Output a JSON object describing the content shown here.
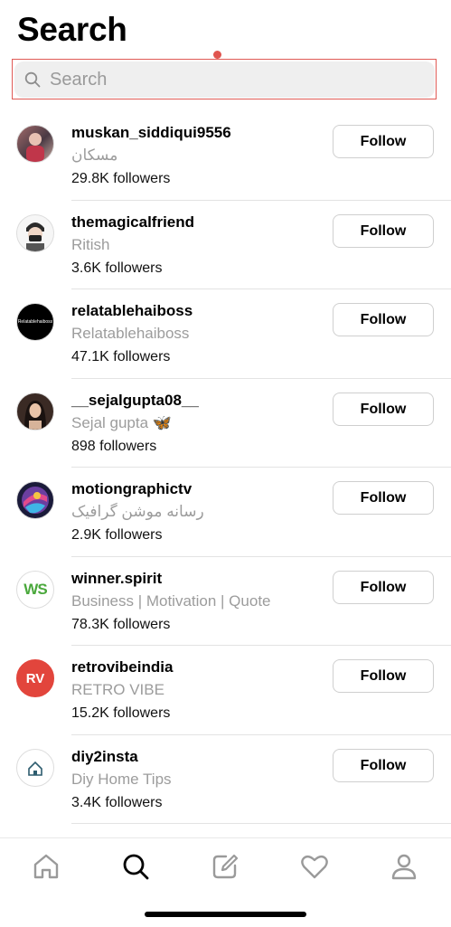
{
  "header": {
    "title": "Search"
  },
  "search": {
    "placeholder": "Search",
    "icon": "search-icon"
  },
  "follow_label": "Follow",
  "users": [
    {
      "username": "muskan_siddiqui9556",
      "display_name": "مسکان",
      "followers": "29.8K followers"
    },
    {
      "username": "themagicalfriend",
      "display_name": "Ritish",
      "followers": "3.6K followers"
    },
    {
      "username": "relatablehaiboss",
      "display_name": "Relatablehaiboss",
      "followers": "47.1K followers",
      "avatar_text": "Relatablehaiboss"
    },
    {
      "username": "__sejalgupta08__",
      "display_name": "Sejal gupta 🦋",
      "followers": "898 followers"
    },
    {
      "username": "motiongraphictv",
      "display_name": "رسانه موشن گرافیک",
      "followers": "2.9K followers"
    },
    {
      "username": "winner.spirit",
      "display_name": "Business | Motivation | Quote",
      "followers": "78.3K followers",
      "avatar_text": "WS"
    },
    {
      "username": "retrovibeindia",
      "display_name": "RETRO VIBE",
      "followers": "15.2K followers",
      "avatar_text": "RV"
    },
    {
      "username": "diy2insta",
      "display_name": "Diy Home Tips",
      "followers": "3.4K followers"
    }
  ],
  "tabbar": [
    "home-icon",
    "search-icon",
    "compose-icon",
    "heart-icon",
    "profile-icon"
  ],
  "colors": {
    "accent_red": "#e0554f",
    "muted_text": "#9c9c9c"
  }
}
